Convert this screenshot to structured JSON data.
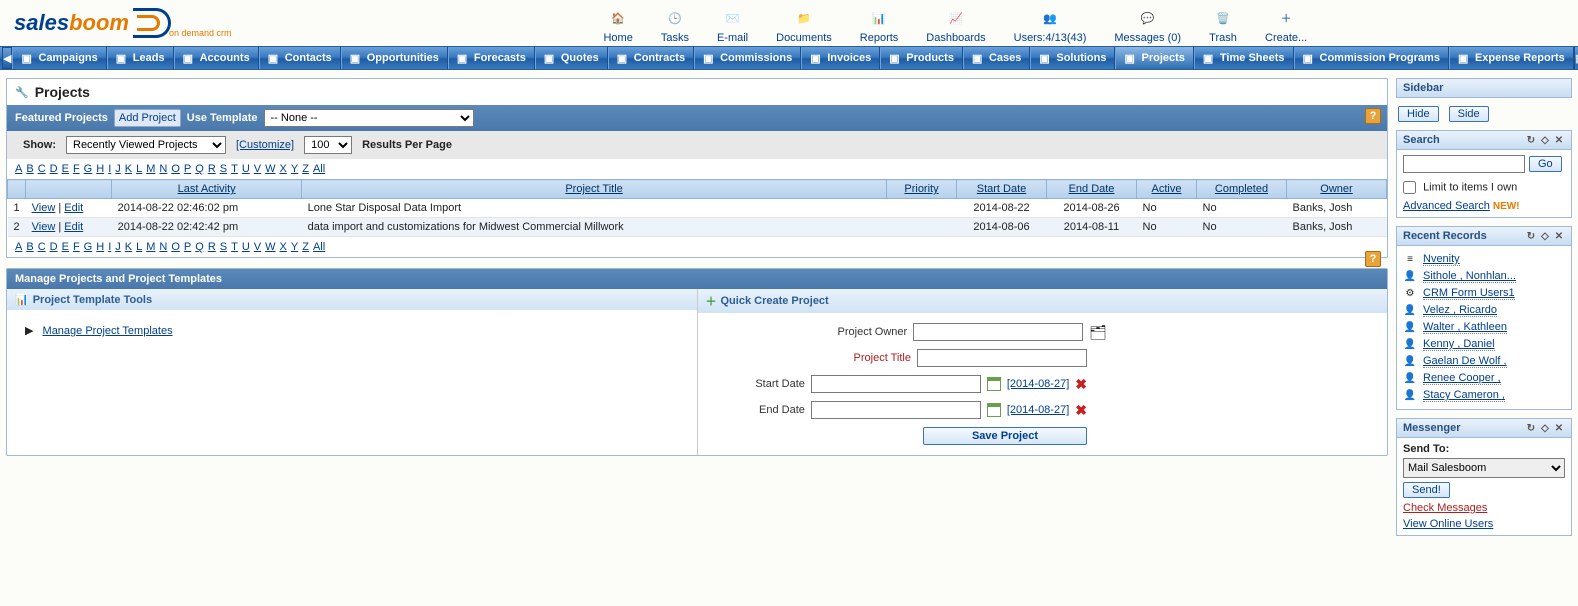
{
  "logo": {
    "part1": "sales",
    "part2": "boom",
    "sub": "on demand crm"
  },
  "topnav": [
    {
      "label": "Home",
      "icon": "🏠"
    },
    {
      "label": "Tasks",
      "icon": "🕒"
    },
    {
      "label": "E-mail",
      "icon": "✉️"
    },
    {
      "label": "Documents",
      "icon": "📁"
    },
    {
      "label": "Reports",
      "icon": "📊"
    },
    {
      "label": "Dashboards",
      "icon": "📈"
    },
    {
      "label": "Users:4/13(43)",
      "icon": "👥"
    },
    {
      "label": "Messages (0)",
      "icon": "💬"
    },
    {
      "label": "Trash",
      "icon": "🗑️"
    },
    {
      "label": "Create...",
      "icon": "＋"
    }
  ],
  "tabs": [
    "Campaigns",
    "Leads",
    "Accounts",
    "Contacts",
    "Opportunities",
    "Forecasts",
    "Quotes",
    "Contracts",
    "Commissions",
    "Invoices",
    "Products",
    "Cases",
    "Solutions",
    "Projects",
    "Time Sheets",
    "Commission Programs",
    "Expense Reports"
  ],
  "active_tab": "Projects",
  "page": {
    "title": "Projects"
  },
  "featured": {
    "label": "Featured Projects",
    "add_btn": "Add Project",
    "use_template": "Use Template",
    "template_option": "-- None --"
  },
  "filterbar": {
    "show": "Show:",
    "show_option": "Recently Viewed Projects",
    "customize": "[Customize]",
    "per_page_value": "100",
    "per_page_label": "Results Per Page"
  },
  "alpha": [
    "A",
    "B",
    "C",
    "D",
    "E",
    "F",
    "G",
    "H",
    "I",
    "J",
    "K",
    "L",
    "M",
    "N",
    "O",
    "P",
    "Q",
    "R",
    "S",
    "T",
    "U",
    "V",
    "W",
    "X",
    "Y",
    "Z",
    "All"
  ],
  "columns": {
    "activity": "Last Activity",
    "title": "Project Title",
    "priority": "Priority",
    "start": "Start Date",
    "end": "End Date",
    "active": "Active",
    "completed": "Completed",
    "owner": "Owner"
  },
  "view": "View",
  "edit": "Edit",
  "rows": [
    {
      "n": "1",
      "activity": "2014-08-22 02:46:02 pm",
      "title": "Lone Star Disposal Data Import",
      "priority": "",
      "start": "2014-08-22",
      "end": "2014-08-26",
      "active": "No",
      "completed": "No",
      "owner": "Banks, Josh"
    },
    {
      "n": "2",
      "activity": "2014-08-22 02:42:42 pm",
      "title": "data import and customizations for Midwest Commercial Millwork",
      "priority": "",
      "start": "2014-08-06",
      "end": "2014-08-11",
      "active": "No",
      "completed": "No",
      "owner": "Banks, Josh"
    }
  ],
  "manage": {
    "header": "Manage Projects and Project Templates",
    "tools_title": "Project Template Tools",
    "tools_link": "Manage Project Templates",
    "quick_title": "Quick Create Project",
    "labels": {
      "owner": "Project Owner",
      "title": "Project Title",
      "start": "Start Date",
      "end": "End Date"
    },
    "date_default": "[2014-08-27]",
    "save": "Save Project"
  },
  "sidebar": {
    "title": "Sidebar",
    "hide": "Hide",
    "side": "Side",
    "search_title": "Search",
    "go": "Go",
    "limit": "Limit to items I own",
    "adv": "Advanced Search",
    "new": "NEW!",
    "recent_title": "Recent Records",
    "records": [
      {
        "icon": "≡",
        "name": "Nvenity"
      },
      {
        "icon": "👤",
        "name": "Sithole , Nonhlan..."
      },
      {
        "icon": "⚙",
        "name": "CRM Form Users1"
      },
      {
        "icon": "👤",
        "name": "Velez , Ricardo"
      },
      {
        "icon": "👤",
        "name": "Walter , Kathleen"
      },
      {
        "icon": "👤",
        "name": "Kenny , Daniel"
      },
      {
        "icon": "👤",
        "name": "Gaelan De Wolf ,"
      },
      {
        "icon": "👤",
        "name": "Renee Cooper ,"
      },
      {
        "icon": "👤",
        "name": "Stacy Cameron ,"
      }
    ],
    "msg_title": "Messenger",
    "send_to": "Send To:",
    "send_opt": "Mail Salesboom",
    "send_btn": "Send!",
    "check": "Check Messages",
    "view_online": "View Online Users"
  }
}
